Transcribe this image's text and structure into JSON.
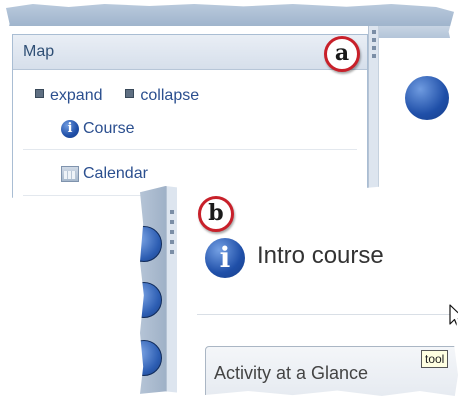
{
  "panel_a": {
    "badge": "a",
    "sidebar": {
      "title": "Map",
      "expand_label": "expand",
      "collapse_label": "collapse",
      "items": [
        {
          "label": "Course",
          "icon": "info-icon"
        },
        {
          "label": "Calendar",
          "icon": "calendar-icon"
        }
      ]
    }
  },
  "panel_b": {
    "badge": "b",
    "page_title": "Intro course",
    "tooltip": "tool",
    "section_title": "Activity at a Glance"
  },
  "colors": {
    "link": "#2b4f8f",
    "badge_border": "#c8202a",
    "header_bg": "#d6dfeb",
    "icon_blue": "#1f4fa8"
  }
}
